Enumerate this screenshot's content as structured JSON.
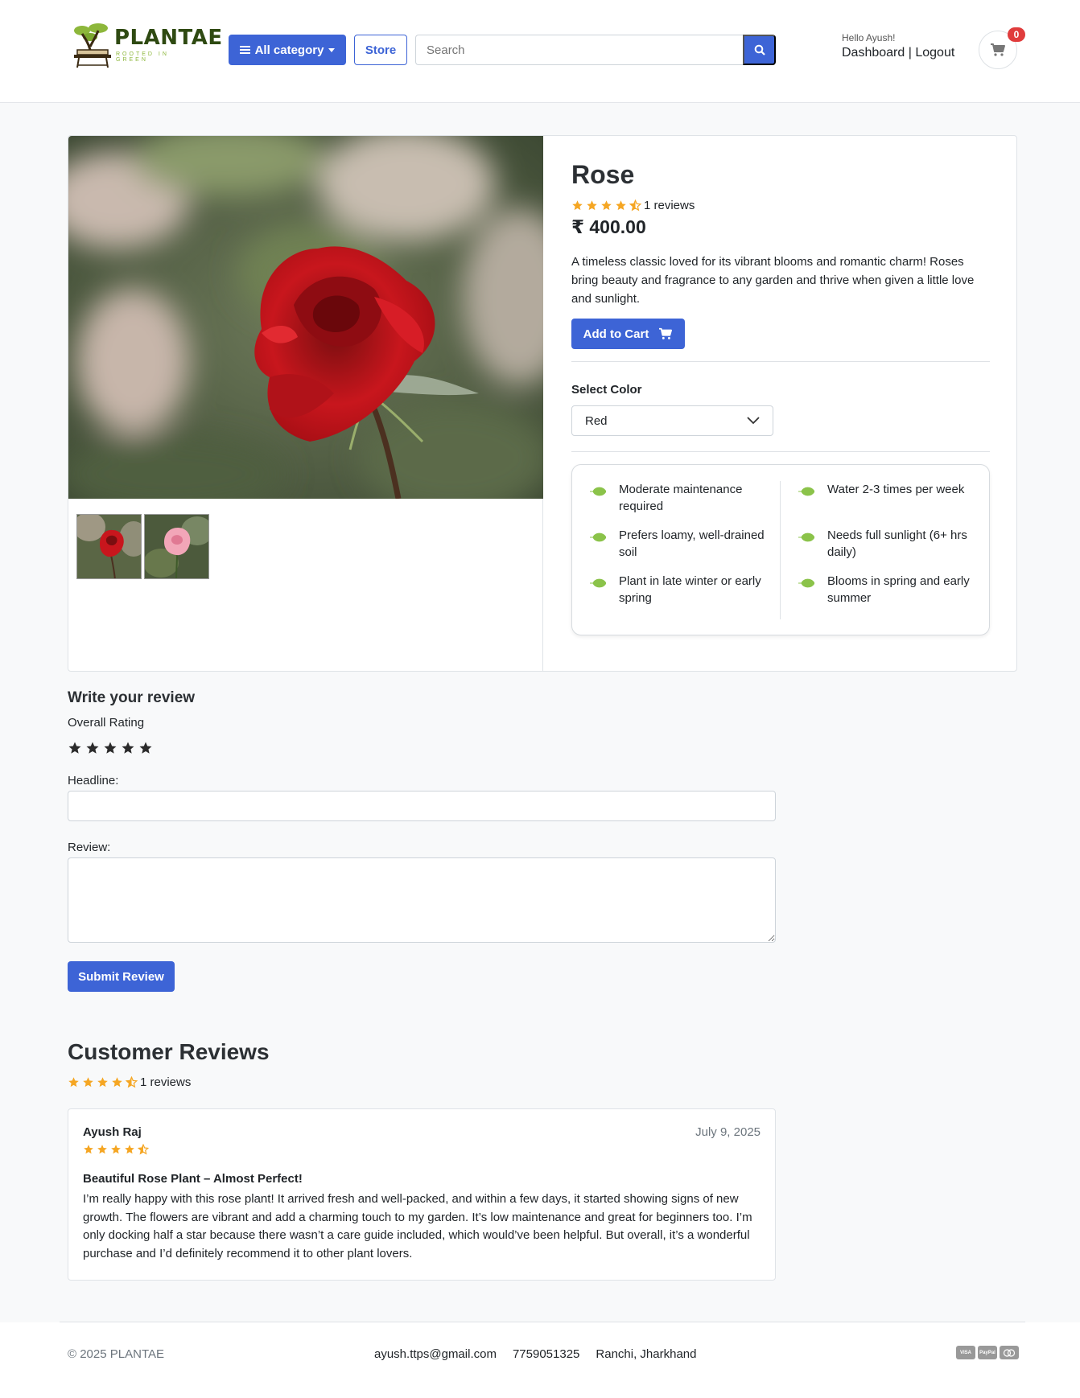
{
  "header": {
    "logo_text": "PLANTAE",
    "logo_tagline": "ROOTED IN GREEN",
    "category_button": "All category",
    "store_button": "Store",
    "search_placeholder": "Search",
    "greeting": "Hello Ayush!",
    "dashboard_link": "Dashboard",
    "separator": "|",
    "logout_link": "Logout",
    "cart_count": "0"
  },
  "product": {
    "name": "Rose",
    "rating": 4.5,
    "review_count_text": "1 reviews",
    "price": "₹ 400.00",
    "description": "A timeless classic loved for its vibrant blooms and romantic charm! Roses bring beauty and fragrance to any garden and thrive when given a little love and sunlight.",
    "add_to_cart": "Add to Cart",
    "select_color_label": "Select Color",
    "selected_color": "Red",
    "care": [
      "Moderate maintenance required",
      "Water 2-3 times per week",
      "Prefers loamy, well-drained soil",
      "Needs full sunlight (6+ hrs daily)",
      "Plant in late winter or early spring",
      "Blooms in spring and early summer"
    ]
  },
  "review_form": {
    "title": "Write your review",
    "overall_rating_label": "Overall Rating",
    "headline_label": "Headline:",
    "review_label": "Review:",
    "submit": "Submit Review"
  },
  "customer_reviews": {
    "title": "Customer Reviews",
    "rating": 4.5,
    "count_text": "1 reviews",
    "items": [
      {
        "author": "Ayush Raj",
        "date": "July 9, 2025",
        "rating": 4.5,
        "headline": "Beautiful Rose Plant – Almost Perfect!",
        "body": "I’m really happy with this rose plant! It arrived fresh and well-packed, and within a few days, it started showing signs of new growth. The flowers are vibrant and add a charming touch to my garden. It’s low maintenance and great for beginners too. I’m only docking half a star because there wasn’t a care guide included, which would’ve been helpful. But overall, it’s a wonderful purchase and I’d definitely recommend it to other plant lovers."
      }
    ]
  },
  "footer": {
    "copyright": "© 2025 PLANTAE",
    "email": "ayush.ttps@gmail.com",
    "phone": "7759051325",
    "location": "Ranchi, Jharkhand",
    "payment_icons": [
      "visa-icon",
      "paypal-icon",
      "mastercard-icon"
    ]
  },
  "colors": {
    "primary": "#3d64d6",
    "star": "#f5a623",
    "leaf": "#8bc34a",
    "badge": "#e03c3c"
  }
}
